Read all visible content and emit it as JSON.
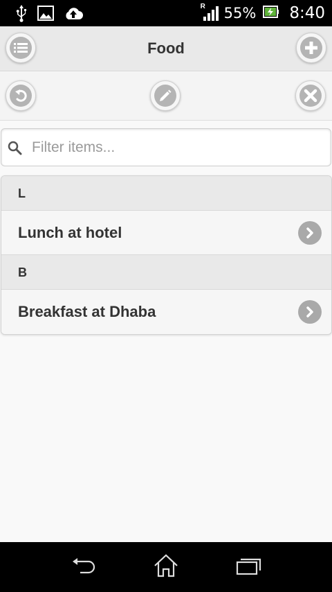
{
  "status_bar": {
    "icons": [
      "usb-icon",
      "image-icon",
      "cloud-upload-icon"
    ],
    "signal_label": "R",
    "battery_percent": "55%",
    "time": "8:40"
  },
  "header": {
    "title": "Food",
    "left_icon": "list-icon",
    "right_icon": "plus-icon"
  },
  "toolbar": {
    "buttons": [
      "undo-icon",
      "pencil-icon",
      "close-icon"
    ]
  },
  "search": {
    "placeholder": "Filter items...",
    "value": ""
  },
  "list": {
    "groups": [
      {
        "letter": "L",
        "items": [
          "Lunch at hotel"
        ]
      },
      {
        "letter": "B",
        "items": [
          "Breakfast at Dhaba"
        ]
      }
    ]
  },
  "nav_bar": {
    "buttons": [
      "back-icon",
      "home-icon",
      "recent-apps-icon"
    ]
  },
  "colors": {
    "header_bg": "#e9e9e9",
    "icon_gray": "#b4b4b4",
    "text": "#333333",
    "system_bar": "#000000"
  }
}
